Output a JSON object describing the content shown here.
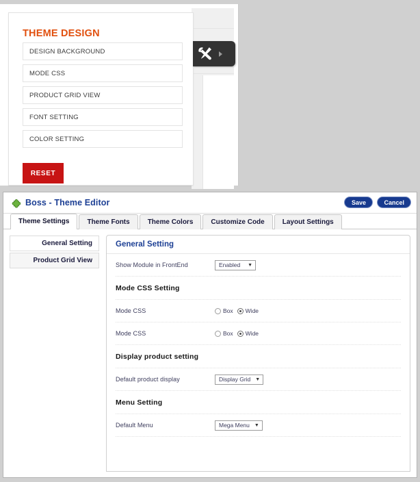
{
  "top_screenshot": {
    "theme_panel": {
      "title": "THEME DESIGN",
      "items": [
        "DESIGN BACKGROUND",
        "MODE CSS",
        "PRODUCT GRID VIEW",
        "FONT SETTING",
        "COLOR SETTING"
      ],
      "reset_label": "RESET",
      "reset_color": "#c71414",
      "title_color": "#e1500f"
    },
    "tool_tab": {
      "icon": "wrench-pencil-icon",
      "arrow_icon": "triangle-right-icon",
      "background": "#333333"
    }
  },
  "modal": {
    "icon": "plugin-puzzle-icon",
    "title": "Boss - Theme Editor",
    "title_color": "#1c3f94",
    "buttons": {
      "save": "Save",
      "cancel": "Cancel",
      "accent": "#173a8f"
    },
    "tabs": [
      {
        "label": "Theme Settings",
        "active": true
      },
      {
        "label": "Theme Fonts",
        "active": false
      },
      {
        "label": "Theme Colors",
        "active": false
      },
      {
        "label": "Customize Code",
        "active": false
      },
      {
        "label": "Layout Settings",
        "active": false
      }
    ],
    "side_nav": [
      {
        "label": "General Setting"
      },
      {
        "label": "Product Grid View"
      }
    ],
    "content": {
      "heading": "General Setting",
      "rows": [
        {
          "kind": "select",
          "label": "Show Module in FrontEnd",
          "value": "Enabled"
        },
        {
          "kind": "section",
          "label": "Mode CSS Setting"
        },
        {
          "kind": "radio",
          "label": "Mode CSS",
          "options": [
            {
              "label": "Box",
              "selected": false
            },
            {
              "label": "Wide",
              "selected": true
            }
          ]
        },
        {
          "kind": "radio",
          "label": "Mode CSS",
          "options": [
            {
              "label": "Box",
              "selected": false
            },
            {
              "label": "Wide",
              "selected": true
            }
          ]
        },
        {
          "kind": "section",
          "label": "Display product setting"
        },
        {
          "kind": "select",
          "label": "Default product display",
          "value": "Display Grid"
        },
        {
          "kind": "section",
          "label": "Menu Setting"
        },
        {
          "kind": "select",
          "label": "Default Menu",
          "value": "Mega Menu"
        }
      ]
    }
  }
}
